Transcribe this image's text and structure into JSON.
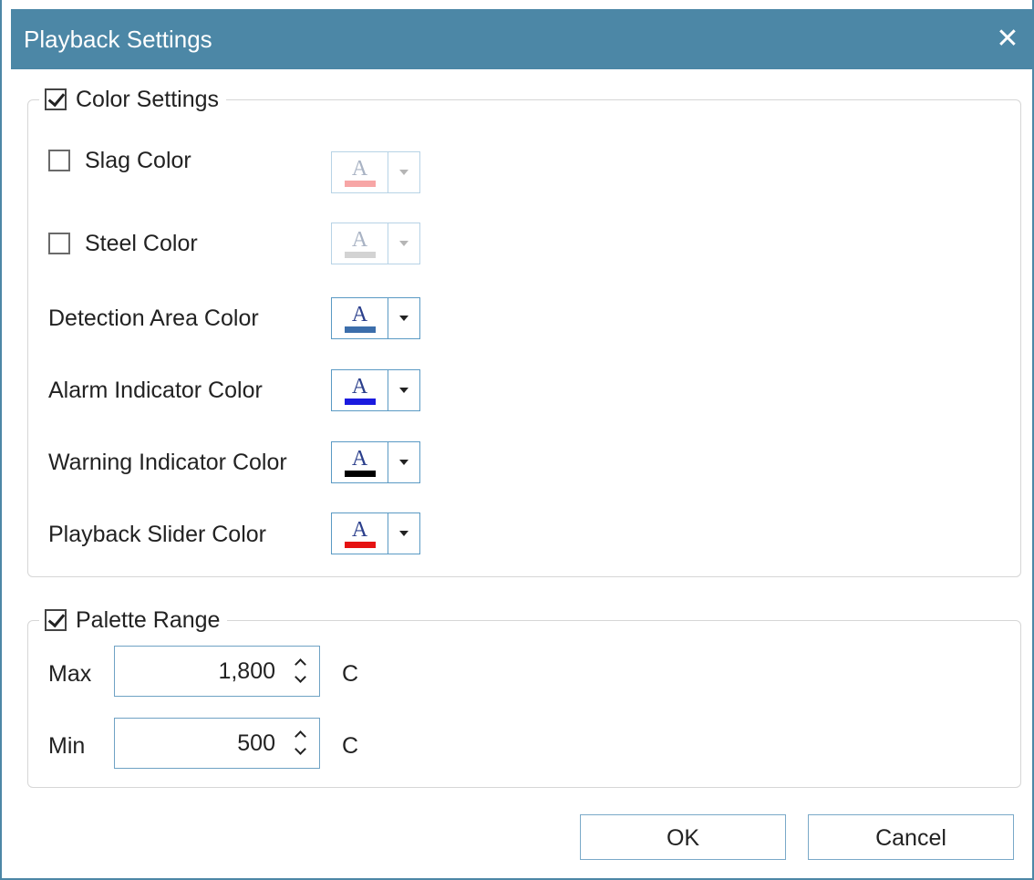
{
  "dialog": {
    "title": "Playback Settings",
    "close_glyph": "✕"
  },
  "color_settings": {
    "legend": "Color Settings",
    "checked": true,
    "rows": [
      {
        "label": "Slag Color",
        "has_checkbox": true,
        "checked": false,
        "enabled": false,
        "color": "#f7a6a6"
      },
      {
        "label": "Steel Color",
        "has_checkbox": true,
        "checked": false,
        "enabled": false,
        "color": "#d3d3d3"
      },
      {
        "label": "Detection Area Color",
        "has_checkbox": false,
        "enabled": true,
        "color": "#3c6eab"
      },
      {
        "label": "Alarm Indicator Color",
        "has_checkbox": false,
        "enabled": true,
        "color": "#1a1adf"
      },
      {
        "label": "Warning Indicator Color",
        "has_checkbox": false,
        "enabled": true,
        "color": "#000000"
      },
      {
        "label": "Playback Slider Color",
        "has_checkbox": false,
        "enabled": true,
        "color": "#e51212"
      }
    ],
    "picker_glyph": "A"
  },
  "palette_range": {
    "legend": "Palette Range",
    "checked": true,
    "max": {
      "label": "Max",
      "value": "1,800",
      "unit": "C"
    },
    "min": {
      "label": "Min",
      "value": "500",
      "unit": "C"
    }
  },
  "buttons": {
    "ok": "OK",
    "cancel": "Cancel"
  },
  "colors": {
    "titlebar": "#4c87a6",
    "accent_border": "#5a9ac4"
  }
}
